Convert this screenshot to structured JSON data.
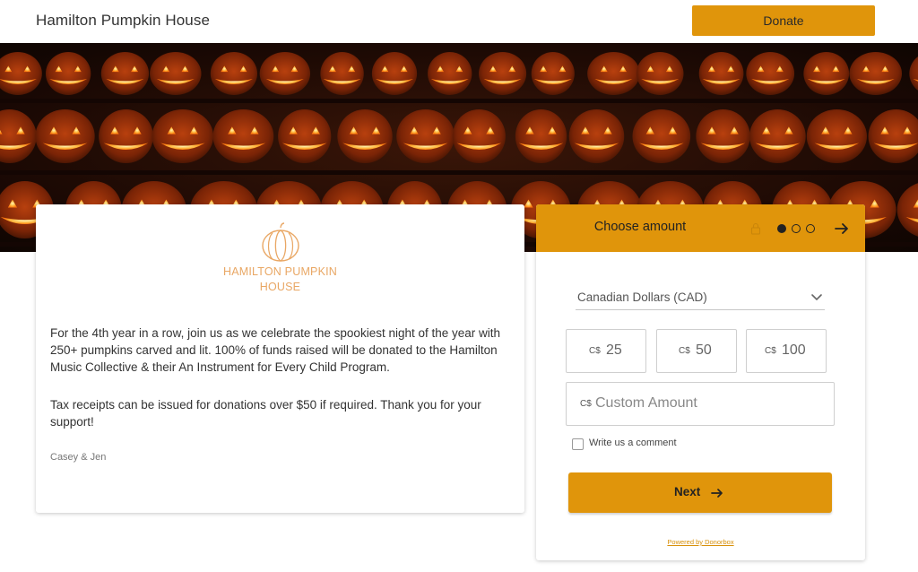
{
  "header": {
    "site_title": "Hamilton Pumpkin House",
    "donate_label": "Donate"
  },
  "hero": {
    "image": "pumpkin-icon"
  },
  "info_card": {
    "logo_icon": "pumpkin-icon",
    "logo_line1": "HAMILTON PUMPKIN",
    "logo_line2": "HOUSE",
    "paragraph1": "For the 4th year in a row, join us as we celebrate the spookiest night of the year with 250+ pumpkins carved and lit. 100% of funds raised will be donated to the Hamilton Music Collective & their An Instrument for Every Child Program.",
    "paragraph2": "Tax receipts can be issued for donations over $50 if required. Thank you for your support!",
    "signature": "Casey & Jen"
  },
  "donation_form": {
    "header_title": "Choose amount",
    "lock_icon": "lock-icon",
    "step_current": 1,
    "step_total": 3,
    "next_arrow_icon": "arrow-right-icon",
    "currency": "Canadian Dollars (CAD)",
    "currency_symbol": "C$",
    "amounts": [
      {
        "symbol": "C$",
        "value": "25"
      },
      {
        "symbol": "C$",
        "value": "50"
      },
      {
        "symbol": "C$",
        "value": "100"
      }
    ],
    "custom_amount_symbol": "C$",
    "custom_amount_placeholder": "Custom Amount",
    "comment_label": "Write us a comment",
    "comment_checked": false,
    "next_label": "Next",
    "powered_by": "Powered by Donorbox"
  },
  "colors": {
    "accent": "#e0950b",
    "logo": "#e9a764",
    "hero_dark": "#1b0904",
    "pumpkin_glow": "#f5a53a"
  }
}
